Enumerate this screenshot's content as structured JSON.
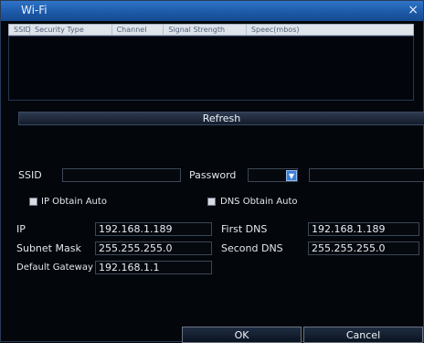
{
  "window": {
    "title": "Wi-Fi",
    "close_symbol": "×"
  },
  "table": {
    "columns": [
      "SSID",
      "Security Type",
      "Channel",
      "Signal Strength",
      "Speec(mbos)"
    ]
  },
  "actions": {
    "refresh": "Refresh",
    "ok": "OK",
    "cancel": "Cancel"
  },
  "form": {
    "ssid_label": "SSID",
    "password_label": "Password",
    "ip_obtain_auto": "IP Obtain Auto",
    "dns_obtain_auto": "DNS Obtain Auto",
    "ip_label": "IP",
    "ip_value": "192.168.1.189",
    "first_dns_label": "First DNS",
    "first_dns_value": "192.168.1.189",
    "subnet_mask_label": "Subnet Mask",
    "subnet_mask_value": "255.255.255.0",
    "second_dns_label": "Second DNS",
    "second_dns_value": "255.255.255.0",
    "default_gateway_label": "Default Gateway",
    "default_gateway_value": "192.168.1.1"
  }
}
